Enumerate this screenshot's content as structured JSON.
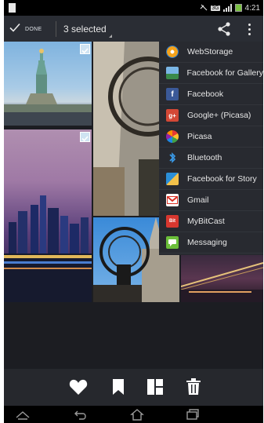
{
  "status_bar": {
    "time": "4:21",
    "badge": "3G"
  },
  "action_bar": {
    "done_label": "DONE",
    "selection_label": "3 selected"
  },
  "share_menu": {
    "items": [
      {
        "label": "WebStorage",
        "icon": "webstorage-icon",
        "color": "#f4a21a"
      },
      {
        "label": "Facebook for Gallery",
        "icon": "gallery-icon",
        "color": "#3a8a4a"
      },
      {
        "label": "Facebook",
        "icon": "facebook-icon",
        "color": "#3b5998"
      },
      {
        "label": "Google+ (Picasa)",
        "icon": "google-plus-icon",
        "color": "#d34836"
      },
      {
        "label": "Picasa",
        "icon": "picasa-icon",
        "color": "#e3e3e3"
      },
      {
        "label": "Bluetooth",
        "icon": "bluetooth-icon",
        "color": "#1c7fd6"
      },
      {
        "label": "Facebook for Story",
        "icon": "story-icon",
        "color": "#2b8fd8"
      },
      {
        "label": "Gmail",
        "icon": "gmail-icon",
        "color": "#d93025"
      },
      {
        "label": "MyBitCast",
        "icon": "mybitcast-icon",
        "color": "#d8372f"
      },
      {
        "label": "Messaging",
        "icon": "messaging-icon",
        "color": "#6bbf3a"
      }
    ]
  },
  "photos": [
    {
      "name": "statue-of-liberty-photo",
      "selected": true
    },
    {
      "name": "atlas-sculpture-sky-photo",
      "selected": false
    },
    {
      "name": "city-night-skyline-photo",
      "selected": true
    },
    {
      "name": "atlas-cathedral-photo",
      "selected": false
    },
    {
      "name": "bridge-night-photo",
      "selected": false
    }
  ],
  "toolbar": {
    "items": [
      "favorite-icon",
      "bookmark-icon",
      "collage-icon",
      "delete-icon"
    ]
  },
  "nav_bar": {
    "items": [
      "back-icon",
      "home-icon",
      "recents-icon"
    ]
  },
  "colors": {
    "action_bar": "#2a2d34",
    "menu": "#282a30",
    "check": "#cfe3f2"
  }
}
